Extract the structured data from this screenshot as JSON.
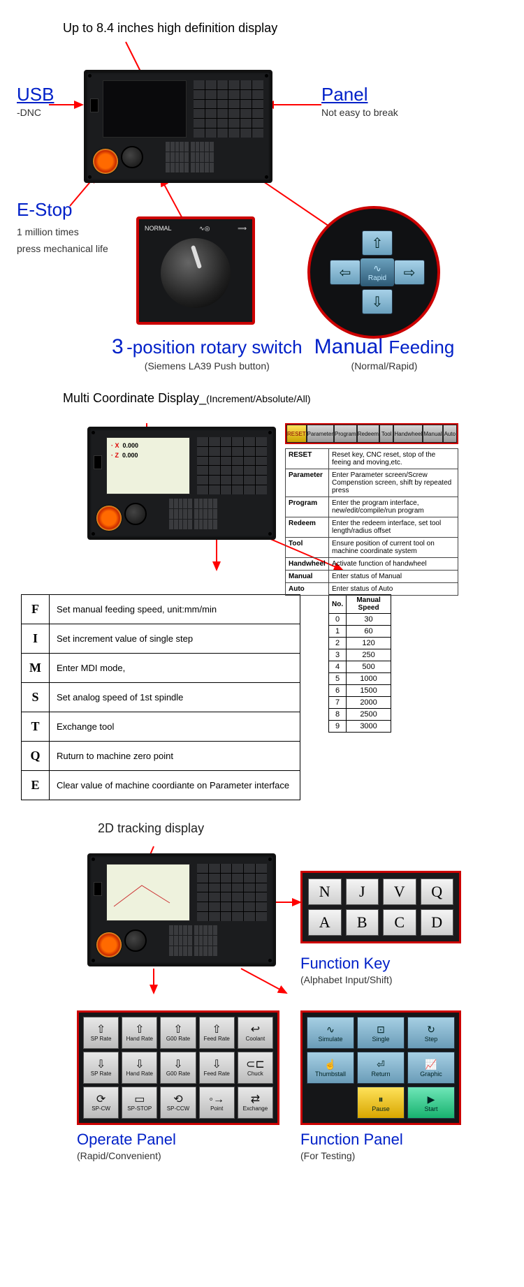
{
  "callouts": {
    "display": {
      "title": "Up to 8.4 inches high definition display"
    },
    "usb": {
      "title": "USB",
      "sub": "-DNC"
    },
    "panel": {
      "title": "Panel",
      "sub": "Not easy to break"
    },
    "estop": {
      "title": "E-Stop",
      "sub1": "1 million times",
      "sub2": "press mechanical life"
    },
    "rotary": {
      "title_num": "3",
      "title_rest": "-position rotary switch",
      "sub": "(Siemens LA39 Push button)"
    },
    "manual": {
      "title1": "Manual ",
      "title2": "Feeding",
      "sub": "(Normal/Rapid)"
    },
    "multi": {
      "title": "Multi Coordinate Display_",
      "sub": "(Increment/Absolute/All)"
    },
    "tracking": {
      "title": "2D tracking display"
    },
    "fkey": {
      "title": "Function Key",
      "sub": "(Alphabet Input/Shift)"
    },
    "operate": {
      "title": "Operate Panel",
      "sub": "(Rapid/Convenient)"
    },
    "fnpanel": {
      "title": "Function Panel",
      "sub": "(For Testing)"
    }
  },
  "rotary_icons": {
    "a": "NORMAL",
    "b": "∿◎",
    "c": "⟹"
  },
  "rapid_label": "Rapid",
  "coord_labels": {
    "x": "· X",
    "z": "· Z",
    "xval": "0.000",
    "zval": "0.000"
  },
  "tabs": [
    "RESET",
    "Parameter",
    "Program",
    "Redeem",
    "Tool",
    "Handwheel",
    "Manual",
    "Auto"
  ],
  "tab_desc": [
    [
      "RESET",
      "Reset key, CNC reset, stop of the feeing and moving,etc."
    ],
    [
      "Parameter",
      "Enter Parameter screen/Screw Compenstion screen, shift by repeated press"
    ],
    [
      "Program",
      "Enter the program interface, new/edit/compile/run program"
    ],
    [
      "Redeem",
      "Enter the redeem interface, set tool length/radius offset"
    ],
    [
      "Tool",
      "Ensure position of current tool on machine coordinate system"
    ],
    [
      "Handwheel",
      "Activate function of handwheel"
    ],
    [
      "Manual",
      "Enter status of Manual"
    ],
    [
      "Auto",
      "Enter status of Auto"
    ]
  ],
  "keys_table": [
    [
      "F",
      "Set manual feeding speed, unit:mm/min"
    ],
    [
      "I",
      "Set increment value of single step"
    ],
    [
      "M",
      "Enter MDI mode,"
    ],
    [
      "S",
      "Set analog speed of 1st spindle"
    ],
    [
      "T",
      "Exchange tool"
    ],
    [
      "Q",
      "Ruturn to machine zero point"
    ],
    [
      "E",
      "Clear value of machine coordiante on Parameter interface"
    ]
  ],
  "speed_header": {
    "c1": "No.",
    "c2": "Manual Speed"
  },
  "speed_rows": [
    [
      "0",
      "30"
    ],
    [
      "1",
      "60"
    ],
    [
      "2",
      "120"
    ],
    [
      "3",
      "250"
    ],
    [
      "4",
      "500"
    ],
    [
      "5",
      "1000"
    ],
    [
      "6",
      "1500"
    ],
    [
      "7",
      "2000"
    ],
    [
      "8",
      "2500"
    ],
    [
      "9",
      "3000"
    ]
  ],
  "fkeys": [
    "N",
    "J",
    "V",
    "Q",
    "A",
    "B",
    "C",
    "D"
  ],
  "op_buttons": [
    {
      "ic": "⇧",
      "t": "SP Rate"
    },
    {
      "ic": "⇧",
      "t": "Hand Rate"
    },
    {
      "ic": "⇧",
      "t": "G00 Rate"
    },
    {
      "ic": "⇧",
      "t": "Feed Rate"
    },
    {
      "ic": "↩",
      "t": "Coolant"
    },
    {
      "ic": "⇩",
      "t": "SP Rate"
    },
    {
      "ic": "⇩",
      "t": "Hand Rate"
    },
    {
      "ic": "⇩",
      "t": "G00 Rate"
    },
    {
      "ic": "⇩",
      "t": "Feed Rate"
    },
    {
      "ic": "⊂⊏",
      "t": "Chuck"
    },
    {
      "ic": "⟳",
      "t": "SP-CW"
    },
    {
      "ic": "▭",
      "t": "SP-STOP"
    },
    {
      "ic": "⟲",
      "t": "SP-CCW"
    },
    {
      "ic": "◦→",
      "t": "Point"
    },
    {
      "ic": "⇄",
      "t": "Exchange"
    }
  ],
  "fn_buttons": [
    {
      "ic": "∿",
      "t": "Simulate",
      "cls": ""
    },
    {
      "ic": "⊡",
      "t": "Single",
      "cls": ""
    },
    {
      "ic": "↻",
      "t": "Step",
      "cls": ""
    },
    {
      "ic": "☝",
      "t": "Thumbstall",
      "cls": ""
    },
    {
      "ic": "⏎",
      "t": "Return",
      "cls": ""
    },
    {
      "ic": "📈",
      "t": "Graphic",
      "cls": ""
    },
    {
      "ic": "",
      "t": "",
      "cls": "blank"
    },
    {
      "ic": "⏸",
      "t": "Pause",
      "cls": "yellow"
    },
    {
      "ic": "▶",
      "t": "Start",
      "cls": "green"
    }
  ]
}
